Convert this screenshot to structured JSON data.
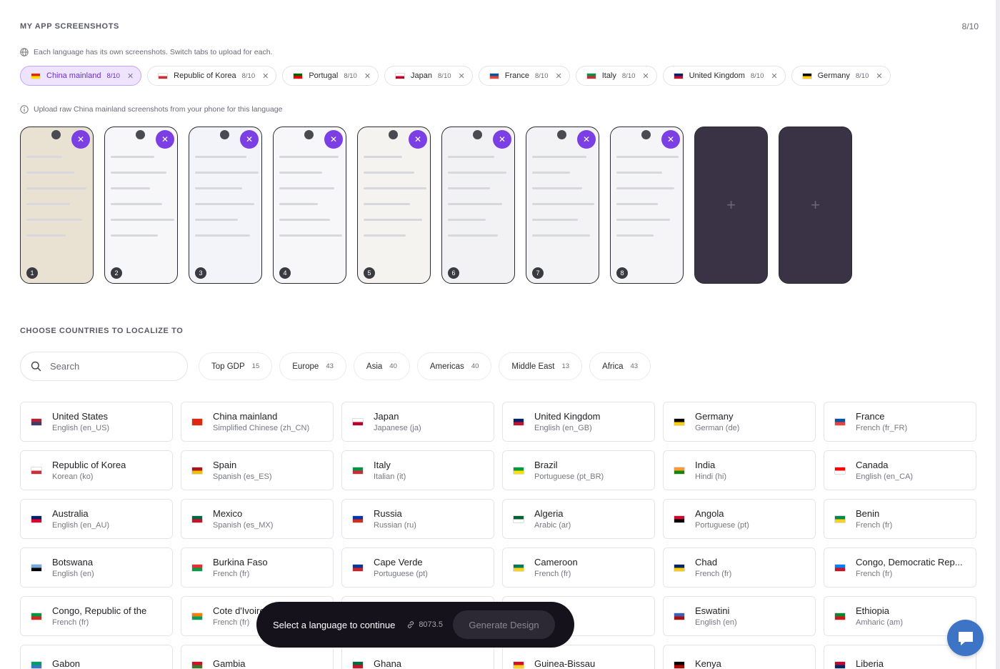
{
  "header": {
    "title": "MY APP SCREENSHOTS",
    "count": "8/10"
  },
  "info_language": "Each language has its own screenshots. Switch tabs to upload for each.",
  "tabs": [
    {
      "label": "China mainland",
      "count": "8/10",
      "flag": [
        "#de2910",
        "#ffde00"
      ],
      "active": true
    },
    {
      "label": "Republic of Korea",
      "count": "8/10",
      "flag": [
        "#ffffff",
        "#cd2e3a"
      ]
    },
    {
      "label": "Portugal",
      "count": "8/10",
      "flag": [
        "#006600",
        "#ff0000"
      ]
    },
    {
      "label": "Japan",
      "count": "8/10",
      "flag": [
        "#ffffff",
        "#bc002d"
      ]
    },
    {
      "label": "France",
      "count": "8/10",
      "flag": [
        "#0055a4",
        "#ef4135"
      ]
    },
    {
      "label": "Italy",
      "count": "8/10",
      "flag": [
        "#009246",
        "#ce2b37"
      ]
    },
    {
      "label": "United Kingdom",
      "count": "8/10",
      "flag": [
        "#012169",
        "#c8102e"
      ]
    },
    {
      "label": "Germany",
      "count": "8/10",
      "flag": [
        "#000000",
        "#ffce00"
      ]
    }
  ],
  "upload_info": "Upload raw China mainland screenshots from your phone for this language",
  "screenshots": [
    {
      "num": "1",
      "bg": "#e9e2d2"
    },
    {
      "num": "2",
      "bg": "#f7f7f9"
    },
    {
      "num": "3",
      "bg": "#f3f4fa"
    },
    {
      "num": "4",
      "bg": "#f7f7f9"
    },
    {
      "num": "5",
      "bg": "#f5f3f0"
    },
    {
      "num": "6",
      "bg": "#f2f2f4"
    },
    {
      "num": "7",
      "bg": "#f3f3f6"
    },
    {
      "num": "8",
      "bg": "#f5f5f7"
    }
  ],
  "empty_slots": [
    "+",
    "+"
  ],
  "countries_section": {
    "title": "CHOOSE COUNTRIES TO LOCALIZE TO"
  },
  "search": {
    "placeholder": "Search"
  },
  "chips": [
    {
      "label": "Top GDP",
      "count": "15"
    },
    {
      "label": "Europe",
      "count": "43"
    },
    {
      "label": "Asia",
      "count": "40"
    },
    {
      "label": "Americas",
      "count": "40"
    },
    {
      "label": "Middle East",
      "count": "13"
    },
    {
      "label": "Africa",
      "count": "43"
    }
  ],
  "countries": [
    {
      "name": "United States",
      "lang": "English (en_US)",
      "flag": [
        "#b22234",
        "#3c3b6e"
      ]
    },
    {
      "name": "China mainland",
      "lang": "Simplified Chinese (zh_CN)",
      "flag": [
        "#de2910",
        "#de2910"
      ]
    },
    {
      "name": "Japan",
      "lang": "Japanese (ja)",
      "flag": [
        "#ffffff",
        "#bc002d"
      ]
    },
    {
      "name": "United Kingdom",
      "lang": "English (en_GB)",
      "flag": [
        "#012169",
        "#c8102e"
      ]
    },
    {
      "name": "Germany",
      "lang": "German (de)",
      "flag": [
        "#000000",
        "#ffce00"
      ]
    },
    {
      "name": "France",
      "lang": "French (fr_FR)",
      "flag": [
        "#0055a4",
        "#ef4135"
      ]
    },
    {
      "name": "Republic of Korea",
      "lang": "Korean (ko)",
      "flag": [
        "#ffffff",
        "#cd2e3a"
      ]
    },
    {
      "name": "Spain",
      "lang": "Spanish (es_ES)",
      "flag": [
        "#aa151b",
        "#f1bf00"
      ]
    },
    {
      "name": "Italy",
      "lang": "Italian (it)",
      "flag": [
        "#009246",
        "#ce2b37"
      ]
    },
    {
      "name": "Brazil",
      "lang": "Portuguese (pt_BR)",
      "flag": [
        "#009c3b",
        "#ffdf00"
      ]
    },
    {
      "name": "India",
      "lang": "Hindi (hi)",
      "flag": [
        "#ff9933",
        "#138808"
      ]
    },
    {
      "name": "Canada",
      "lang": "English (en_CA)",
      "flag": [
        "#ff0000",
        "#ffffff"
      ]
    },
    {
      "name": "Australia",
      "lang": "English (en_AU)",
      "flag": [
        "#012169",
        "#e4002b"
      ]
    },
    {
      "name": "Mexico",
      "lang": "Spanish (es_MX)",
      "flag": [
        "#006847",
        "#ce1126"
      ]
    },
    {
      "name": "Russia",
      "lang": "Russian (ru)",
      "flag": [
        "#0039a6",
        "#d52b1e"
      ]
    },
    {
      "name": "Algeria",
      "lang": "Arabic (ar)",
      "flag": [
        "#006233",
        "#ffffff"
      ]
    },
    {
      "name": "Angola",
      "lang": "Portuguese (pt)",
      "flag": [
        "#cc092f",
        "#000000"
      ]
    },
    {
      "name": "Benin",
      "lang": "French (fr)",
      "flag": [
        "#008751",
        "#fcd116"
      ]
    },
    {
      "name": "Botswana",
      "lang": "English (en)",
      "flag": [
        "#75aadb",
        "#000000"
      ]
    },
    {
      "name": "Burkina Faso",
      "lang": "French (fr)",
      "flag": [
        "#ef2b2d",
        "#009e49"
      ]
    },
    {
      "name": "Cape Verde",
      "lang": "Portuguese (pt)",
      "flag": [
        "#003893",
        "#cf2027"
      ]
    },
    {
      "name": "Cameroon",
      "lang": "French (fr)",
      "flag": [
        "#007a5e",
        "#fcd116"
      ]
    },
    {
      "name": "Chad",
      "lang": "French (fr)",
      "flag": [
        "#002664",
        "#fecb00"
      ]
    },
    {
      "name": "Congo, Democratic Rep...",
      "lang": "French (fr)",
      "flag": [
        "#007fff",
        "#ce1021"
      ]
    },
    {
      "name": "Congo, Republic of the",
      "lang": "French (fr)",
      "flag": [
        "#009543",
        "#dc241f"
      ]
    },
    {
      "name": "Cote d'Ivoire",
      "lang": "French (fr)",
      "flag": [
        "#f77f00",
        "#009e60"
      ]
    },
    {
      "name": "",
      "lang": "",
      "flag": [
        "#ffffff",
        "#ffffff"
      ]
    },
    {
      "name": "",
      "lang": "",
      "flag": [
        "#ffffff",
        "#ffffff"
      ]
    },
    {
      "name": "Eswatini",
      "lang": "English (en)",
      "flag": [
        "#3e5eb9",
        "#b10c0c"
      ]
    },
    {
      "name": "Ethiopia",
      "lang": "Amharic (am)",
      "flag": [
        "#078930",
        "#da121a"
      ]
    },
    {
      "name": "Gabon",
      "lang": "",
      "flag": [
        "#009e60",
        "#3a75c4"
      ]
    },
    {
      "name": "Gambia",
      "lang": "",
      "flag": [
        "#ce1126",
        "#3a7728"
      ]
    },
    {
      "name": "Ghana",
      "lang": "",
      "flag": [
        "#006b3f",
        "#ce1126"
      ]
    },
    {
      "name": "Guinea-Bissau",
      "lang": "",
      "flag": [
        "#ce1126",
        "#fcd116"
      ]
    },
    {
      "name": "Kenya",
      "lang": "",
      "flag": [
        "#000000",
        "#bb0000"
      ]
    },
    {
      "name": "Liberia",
      "lang": "",
      "flag": [
        "#bf0a30",
        "#002868"
      ]
    }
  ],
  "bottombar": {
    "message": "Select a language to continue",
    "credits": "8073.5",
    "button": "Generate Design"
  }
}
